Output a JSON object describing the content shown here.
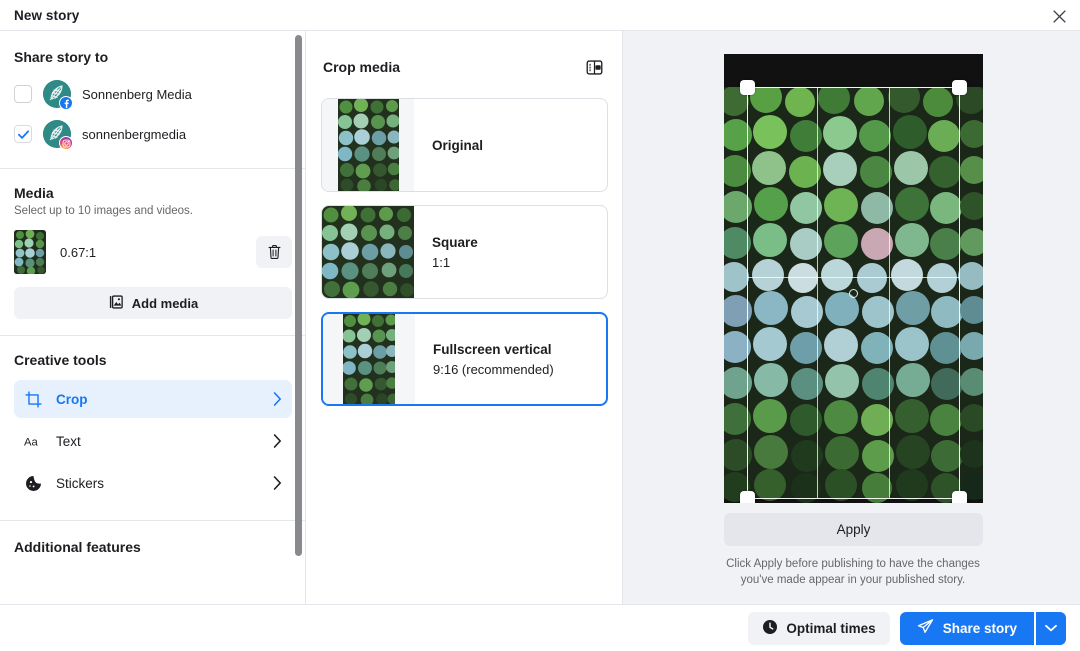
{
  "window": {
    "title": "New story",
    "close_icon": "close-icon"
  },
  "sidebar": {
    "share_section": {
      "heading": "Share story to",
      "accounts": [
        {
          "name": "Sonnenberg Media",
          "platform": "facebook",
          "checked": false
        },
        {
          "name": "sonnenbergmedia",
          "platform": "instagram",
          "checked": true
        }
      ]
    },
    "media_section": {
      "heading": "Media",
      "subtitle": "Select up to 10 images and videos.",
      "items": [
        {
          "ratio": "0.67:1",
          "delete_icon": "trash-icon"
        }
      ],
      "add_media_label": "Add media",
      "add_media_icon": "image-icon"
    },
    "creative_tools": {
      "heading": "Creative tools",
      "items": [
        {
          "label": "Crop",
          "icon": "crop-icon",
          "active": true
        },
        {
          "label": "Text",
          "icon": "text-icon",
          "active": false
        },
        {
          "label": "Stickers",
          "icon": "sticker-icon",
          "active": false
        }
      ]
    },
    "additional_features": {
      "heading": "Additional features"
    }
  },
  "crop_panel": {
    "title": "Crop media",
    "toggle_icon": "panel-split-icon",
    "options": [
      {
        "name": "Original",
        "ratio": "",
        "selected": false
      },
      {
        "name": "Square",
        "ratio": "1:1",
        "selected": false
      },
      {
        "name": "Fullscreen vertical",
        "ratio": "9:16 (recommended)",
        "selected": true
      }
    ]
  },
  "preview": {
    "apply_label": "Apply",
    "hint_line1": "Click Apply before publishing to have the changes",
    "hint_line2": "you've made appear in your published story.",
    "handles": [
      "top-left",
      "top-right",
      "bottom-left",
      "bottom-right"
    ]
  },
  "bottom_bar": {
    "optimal_times_label": "Optimal times",
    "optimal_times_icon": "clock-icon",
    "share_label": "Share story",
    "share_icon": "send-icon",
    "share_caret_icon": "chevron-down-icon"
  },
  "colors": {
    "accent": "#1877f2",
    "accent_soft": "#e7f0fd",
    "surface": "#ffffff",
    "panel_bg": "#f0f2f5",
    "border": "#e4e6eb",
    "text_primary": "#1c1e21",
    "text_secondary": "#65676b",
    "canvas": "#111111"
  }
}
